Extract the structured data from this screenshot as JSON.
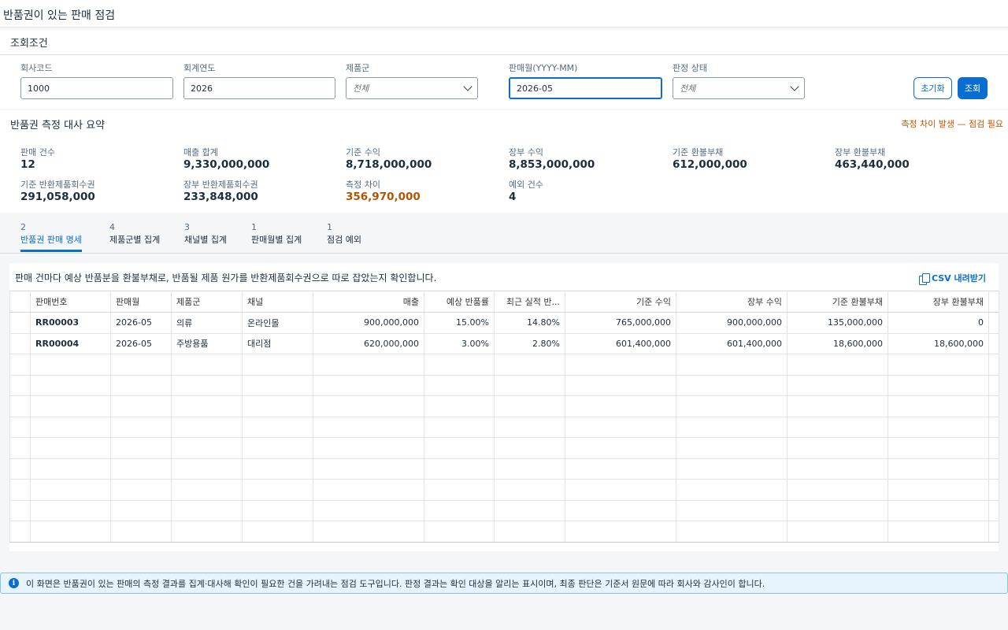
{
  "page_title": "반품권이 있는 판매 점검",
  "filters": {
    "section_title": "조회조건",
    "company_code": {
      "label": "회사코드",
      "value": "1000"
    },
    "fiscal_year": {
      "label": "회계연도",
      "value": "2026"
    },
    "product_group": {
      "label": "제품군",
      "value": "전체"
    },
    "sales_month": {
      "label": "판매월(YYYY-MM)",
      "value": "2026-05"
    },
    "status": {
      "label": "판정 상태",
      "value": "전체"
    },
    "reset_label": "초기화",
    "search_label": "조회"
  },
  "summary": {
    "title": "반품권 측정 대사 요약",
    "status_text": "측정 차이 발생 — 점검 필요",
    "kpis": [
      {
        "label": "판매 건수",
        "value": "12"
      },
      {
        "label": "매출 합계",
        "value": "9,330,000,000"
      },
      {
        "label": "기준 수익",
        "value": "8,718,000,000"
      },
      {
        "label": "장부 수익",
        "value": "8,853,000,000"
      },
      {
        "label": "기준 환불부채",
        "value": "612,000,000"
      },
      {
        "label": "장부 환불부채",
        "value": "463,440,000"
      },
      {
        "label": "기준 반환제품회수권",
        "value": "291,058,000"
      },
      {
        "label": "장부 반환제품회수권",
        "value": "233,848,000"
      },
      {
        "label": "측정 차이",
        "value": "356,970,000"
      },
      {
        "label": "예외 건수",
        "value": "4"
      }
    ]
  },
  "tabs": [
    {
      "count": "2",
      "label": "반품권 판매 명세"
    },
    {
      "count": "4",
      "label": "제품군별 집계"
    },
    {
      "count": "3",
      "label": "채널별 집계"
    },
    {
      "count": "1",
      "label": "판매월별 집계"
    },
    {
      "count": "1",
      "label": "점검 예외"
    }
  ],
  "table": {
    "description": "판매 건마다 예상 반품분을 환불부채로, 반품될 제품 원가를 반환제품회수권으로 따로 잡았는지 확인합니다.",
    "csv_label": "CSV 내려받기",
    "columns": [
      "판매번호",
      "판매월",
      "제품군",
      "채널",
      "매출",
      "예상 반품률",
      "최근 실적 반...",
      "기준 수익",
      "장부 수익",
      "기준 환불부채",
      "장부 환불부채"
    ],
    "rows": [
      [
        "RR00003",
        "2026-05",
        "의류",
        "온라인몰",
        "900,000,000",
        "15.00%",
        "14.80%",
        "765,000,000",
        "900,000,000",
        "135,000,000",
        "0"
      ],
      [
        "RR00004",
        "2026-05",
        "주방용품",
        "대리점",
        "620,000,000",
        "3.00%",
        "2.80%",
        "601,400,000",
        "601,400,000",
        "18,600,000",
        "18,600,000"
      ]
    ]
  },
  "info_text": "이 화면은 반품권이 있는 판매의 측정 결과를 집계·대사해 확인이 필요한 건을 가려내는 점검 도구입니다. 판정 결과는 확인 대상을 알리는 표시이며, 최종 판단은 기준서 원문에 따라 회사와 감사인이 합니다."
}
